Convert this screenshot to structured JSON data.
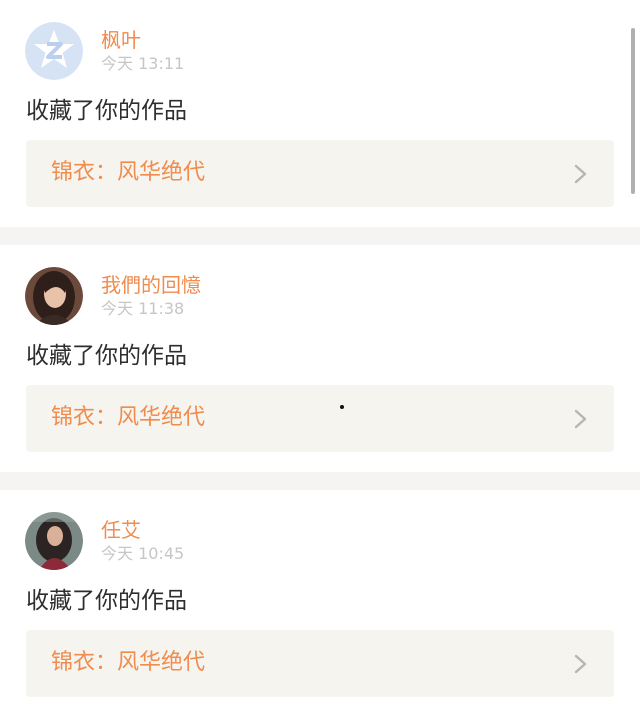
{
  "notifications": [
    {
      "user": "枫叶",
      "time": "今天 13:11",
      "action": "收藏了你的作品",
      "work_title": "锦衣：风华绝代",
      "avatar": "qq-default-avatar"
    },
    {
      "user": "我們的回憶",
      "time": "今天 11:38",
      "action": "收藏了你的作品",
      "work_title": "锦衣：风华绝代",
      "avatar": "user-photo-avatar"
    },
    {
      "user": "任艾",
      "time": "今天 10:45",
      "action": "收藏了你的作品",
      "work_title": "锦衣：风华绝代",
      "avatar": "user-photo-avatar"
    }
  ],
  "colors": {
    "accent": "#f08c4e",
    "time": "#c6c6c6",
    "text": "#2e2e2e",
    "card_bg": "#f5f4ef",
    "separator": "#f5f4f2"
  }
}
